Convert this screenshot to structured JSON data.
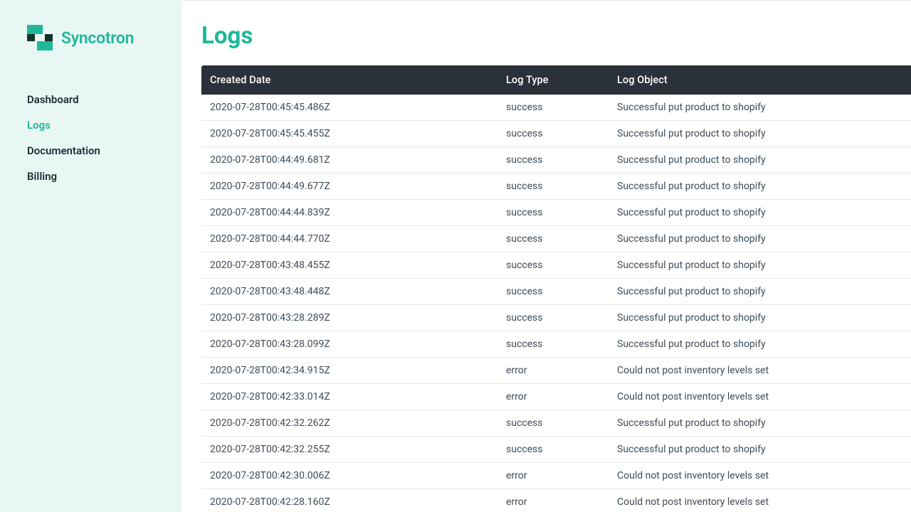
{
  "brand": {
    "name": "Syncotron"
  },
  "sidebar": {
    "items": [
      {
        "label": "Dashboard"
      },
      {
        "label": "Logs"
      },
      {
        "label": "Documentation"
      },
      {
        "label": "Billing"
      }
    ],
    "activeIndex": 1
  },
  "page": {
    "title": "Logs"
  },
  "table": {
    "columns": {
      "created": "Created Date",
      "type": "Log Type",
      "object": "Log Object"
    },
    "rows": [
      {
        "created": "2020-07-28T00:45:45.486Z",
        "type": "success",
        "object": "Successful put product to shopify"
      },
      {
        "created": "2020-07-28T00:45:45.455Z",
        "type": "success",
        "object": "Successful put product to shopify"
      },
      {
        "created": "2020-07-28T00:44:49.681Z",
        "type": "success",
        "object": "Successful put product to shopify"
      },
      {
        "created": "2020-07-28T00:44:49.677Z",
        "type": "success",
        "object": "Successful put product to shopify"
      },
      {
        "created": "2020-07-28T00:44:44.839Z",
        "type": "success",
        "object": "Successful put product to shopify"
      },
      {
        "created": "2020-07-28T00:44:44.770Z",
        "type": "success",
        "object": "Successful put product to shopify"
      },
      {
        "created": "2020-07-28T00:43:48.455Z",
        "type": "success",
        "object": "Successful put product to shopify"
      },
      {
        "created": "2020-07-28T00:43:48.448Z",
        "type": "success",
        "object": "Successful put product to shopify"
      },
      {
        "created": "2020-07-28T00:43:28.289Z",
        "type": "success",
        "object": "Successful put product to shopify"
      },
      {
        "created": "2020-07-28T00:43:28.099Z",
        "type": "success",
        "object": "Successful put product to shopify"
      },
      {
        "created": "2020-07-28T00:42:34.915Z",
        "type": "error",
        "object": "Could not post inventory levels set"
      },
      {
        "created": "2020-07-28T00:42:33.014Z",
        "type": "error",
        "object": "Could not post inventory levels set"
      },
      {
        "created": "2020-07-28T00:42:32.262Z",
        "type": "success",
        "object": "Successful put product to shopify"
      },
      {
        "created": "2020-07-28T00:42:32.255Z",
        "type": "success",
        "object": "Successful put product to shopify"
      },
      {
        "created": "2020-07-28T00:42:30.006Z",
        "type": "error",
        "object": "Could not post inventory levels set"
      },
      {
        "created": "2020-07-28T00:42:28.160Z",
        "type": "error",
        "object": "Could not post inventory levels set"
      }
    ]
  }
}
